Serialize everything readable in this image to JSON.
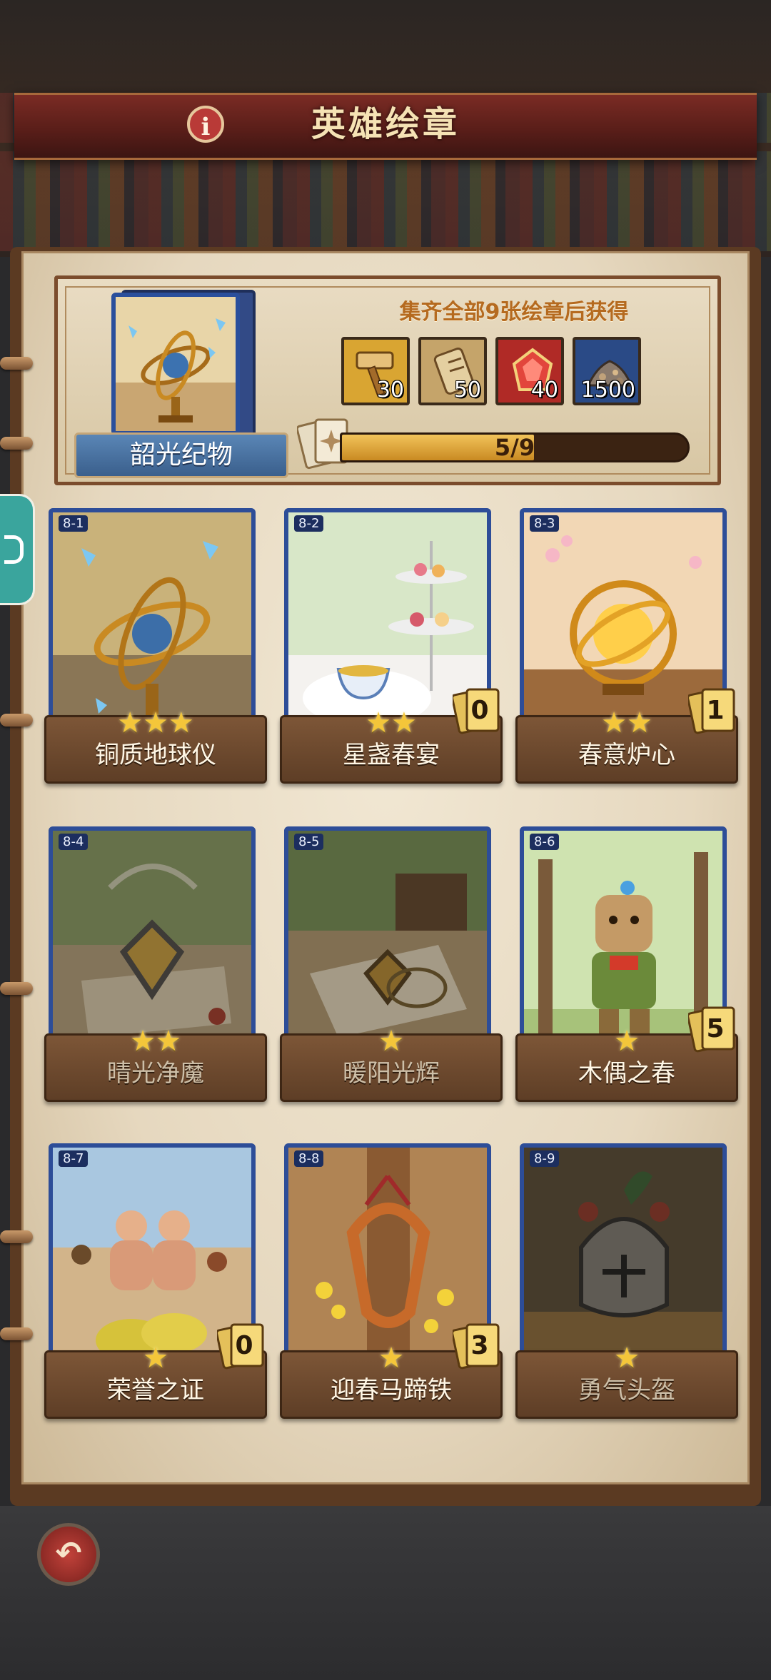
{
  "header": {
    "title": "英雄绘章",
    "info_icon": "i"
  },
  "reward": {
    "caption": "集齐全部9张绘章后获得",
    "name": "韶光纪物",
    "items": [
      {
        "icon": "hammer-icon",
        "value": "30",
        "bg": "#d9a532"
      },
      {
        "icon": "scroll-icon",
        "value": "50",
        "bg": "#c5a46a"
      },
      {
        "icon": "red-gem-icon",
        "value": "40",
        "bg": "#b02a26"
      },
      {
        "icon": "ore-pile-icon",
        "value": "1500",
        "bg": "#2a4a86"
      }
    ],
    "progress": {
      "current": 5,
      "total": 9,
      "label": "5/9"
    }
  },
  "cards": [
    {
      "code": "8-1",
      "name": "铜质地球仪",
      "stars": "★★★",
      "dup": null,
      "locked": false,
      "theme": "armillary"
    },
    {
      "code": "8-2",
      "name": "星盏春宴",
      "stars": "★★",
      "dup": "0",
      "locked": false,
      "theme": "tea"
    },
    {
      "code": "8-3",
      "name": "春意炉心",
      "stars": "★★",
      "dup": "1",
      "locked": false,
      "theme": "core"
    },
    {
      "code": "8-4",
      "name": "晴光净魔",
      "stars": "★★",
      "dup": null,
      "locked": true,
      "theme": "amulet"
    },
    {
      "code": "8-5",
      "name": "暖阳光辉",
      "stars": "★",
      "dup": null,
      "locked": true,
      "theme": "amulet2"
    },
    {
      "code": "8-6",
      "name": "木偶之春",
      "stars": "★",
      "dup": "5",
      "locked": false,
      "theme": "puppet"
    },
    {
      "code": "8-7",
      "name": "荣誉之证",
      "stars": "★",
      "dup": "0",
      "locked": false,
      "theme": "wrestle"
    },
    {
      "code": "8-8",
      "name": "迎春马蹄铁",
      "stars": "★",
      "dup": "3",
      "locked": false,
      "theme": "horseshoe"
    },
    {
      "code": "8-9",
      "name": "勇气头盔",
      "stars": "★",
      "dup": null,
      "locked": true,
      "theme": "helmet"
    }
  ],
  "footer": {
    "back_glyph": "↶"
  }
}
